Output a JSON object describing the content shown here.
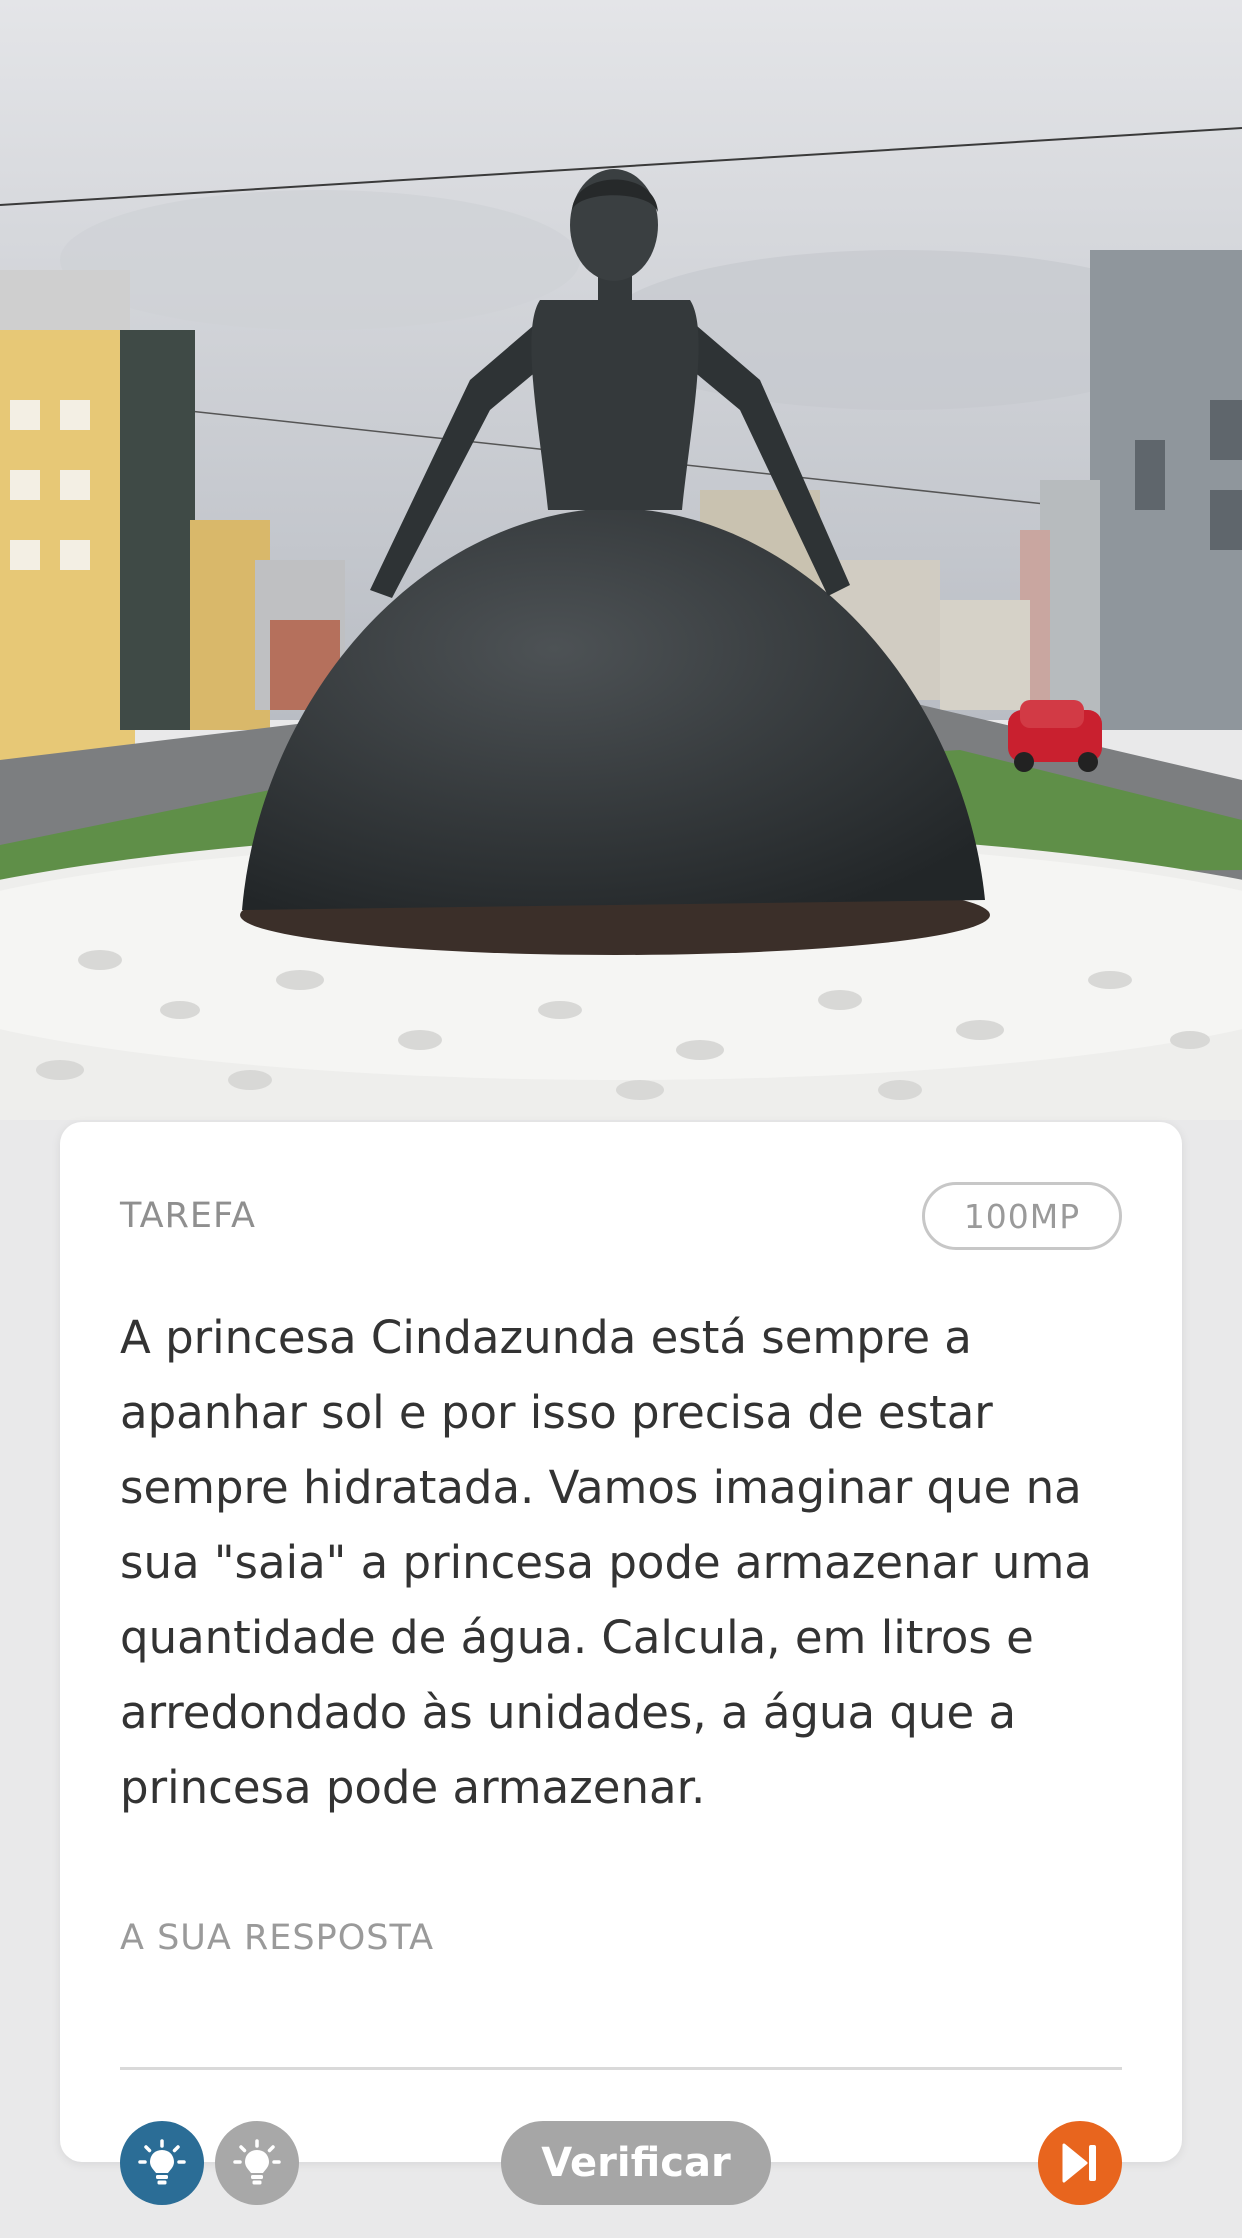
{
  "photo": {
    "subject": "statue-photo"
  },
  "task": {
    "label": "TAREFA",
    "points": "100MP",
    "text": "A princesa Cindazunda está sempre a apanhar sol e por isso precisa de estar sempre hidratada. Vamos imaginar que na sua \"saia\" a princesa pode armazenar uma quantidade de água. Calcula, em litros e arredondado às unidades, a água que a princesa pode armazenar."
  },
  "answer": {
    "label": "A SUA RESPOSTA",
    "value": "",
    "placeholder": ""
  },
  "controls": {
    "verify_label": "Verificar",
    "hint_icon_1": "lightbulb-icon",
    "hint_icon_2": "lightbulb-icon",
    "skip_icon": "skip-forward-icon"
  },
  "colors": {
    "hint_active": "#2b6d96",
    "hint_inactive": "#a8a8a8",
    "verify_disabled": "#a6a6a6",
    "skip": "#e8651e"
  }
}
